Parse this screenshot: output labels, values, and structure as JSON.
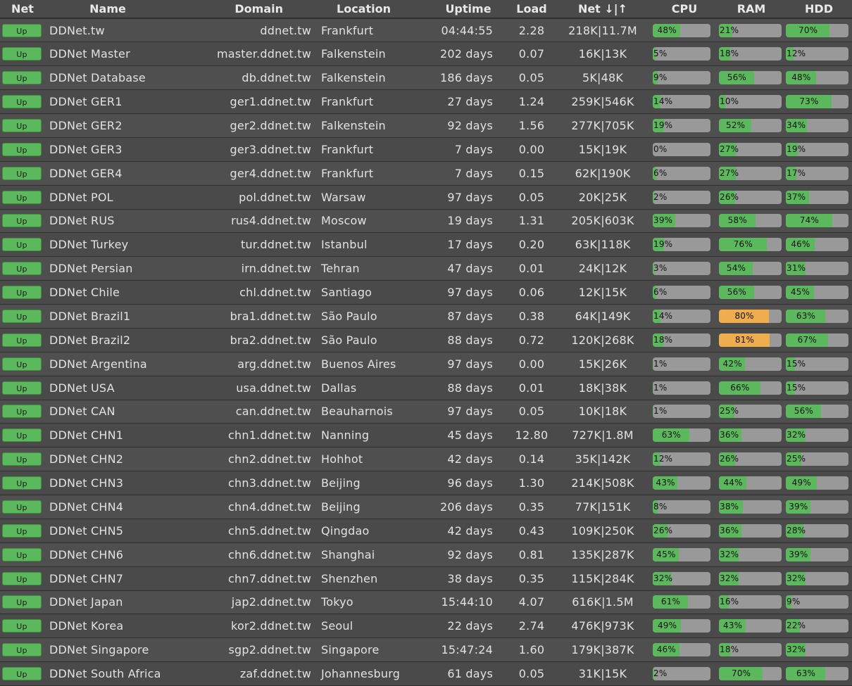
{
  "headers": {
    "net": "Net",
    "name": "Name",
    "domain": "Domain",
    "location": "Location",
    "uptime": "Uptime",
    "load": "Load",
    "netio": "Net ↓|↑",
    "cpu": "CPU",
    "ram": "RAM",
    "hdd": "HDD"
  },
  "colors": {
    "ok": "#5cb85c",
    "warn": "#f0ad4e",
    "track": "#999999"
  },
  "servers": [
    {
      "status": "Up",
      "name": "DDNet.tw",
      "domain": "ddnet.tw",
      "location": "Frankfurt",
      "uptime": "04:44:55",
      "load": "2.28",
      "net": "218K|11.7M",
      "cpu": 48,
      "ram": 21,
      "hdd": 70
    },
    {
      "status": "Up",
      "name": "DDNet Master",
      "domain": "master.ddnet.tw",
      "location": "Falkenstein",
      "uptime": "202 days",
      "load": "0.07",
      "net": "16K|13K",
      "cpu": 5,
      "ram": 18,
      "hdd": 12
    },
    {
      "status": "Up",
      "name": "DDNet Database",
      "domain": "db.ddnet.tw",
      "location": "Falkenstein",
      "uptime": "186 days",
      "load": "0.05",
      "net": "5K|48K",
      "cpu": 9,
      "ram": 56,
      "hdd": 48
    },
    {
      "status": "Up",
      "name": "DDNet GER1",
      "domain": "ger1.ddnet.tw",
      "location": "Frankfurt",
      "uptime": "27 days",
      "load": "1.24",
      "net": "259K|546K",
      "cpu": 14,
      "ram": 10,
      "hdd": 73
    },
    {
      "status": "Up",
      "name": "DDNet GER2",
      "domain": "ger2.ddnet.tw",
      "location": "Falkenstein",
      "uptime": "92 days",
      "load": "1.56",
      "net": "277K|705K",
      "cpu": 19,
      "ram": 52,
      "hdd": 34
    },
    {
      "status": "Up",
      "name": "DDNet GER3",
      "domain": "ger3.ddnet.tw",
      "location": "Frankfurt",
      "uptime": "7 days",
      "load": "0.00",
      "net": "15K|19K",
      "cpu": 0,
      "ram": 27,
      "hdd": 19
    },
    {
      "status": "Up",
      "name": "DDNet GER4",
      "domain": "ger4.ddnet.tw",
      "location": "Frankfurt",
      "uptime": "7 days",
      "load": "0.15",
      "net": "62K|190K",
      "cpu": 6,
      "ram": 27,
      "hdd": 17
    },
    {
      "status": "Up",
      "name": "DDNet POL",
      "domain": "pol.ddnet.tw",
      "location": "Warsaw",
      "uptime": "97 days",
      "load": "0.05",
      "net": "20K|25K",
      "cpu": 2,
      "ram": 26,
      "hdd": 37
    },
    {
      "status": "Up",
      "name": "DDNet RUS",
      "domain": "rus4.ddnet.tw",
      "location": "Moscow",
      "uptime": "19 days",
      "load": "1.31",
      "net": "205K|603K",
      "cpu": 39,
      "ram": 58,
      "hdd": 74
    },
    {
      "status": "Up",
      "name": "DDNet Turkey",
      "domain": "tur.ddnet.tw",
      "location": "Istanbul",
      "uptime": "17 days",
      "load": "0.20",
      "net": "63K|118K",
      "cpu": 19,
      "ram": 76,
      "hdd": 46
    },
    {
      "status": "Up",
      "name": "DDNet Persian",
      "domain": "irn.ddnet.tw",
      "location": "Tehran",
      "uptime": "47 days",
      "load": "0.01",
      "net": "24K|12K",
      "cpu": 3,
      "ram": 54,
      "hdd": 31
    },
    {
      "status": "Up",
      "name": "DDNet Chile",
      "domain": "chl.ddnet.tw",
      "location": "Santiago",
      "uptime": "97 days",
      "load": "0.06",
      "net": "12K|15K",
      "cpu": 6,
      "ram": 56,
      "hdd": 45
    },
    {
      "status": "Up",
      "name": "DDNet Brazil1",
      "domain": "bra1.ddnet.tw",
      "location": "São Paulo",
      "uptime": "87 days",
      "load": "0.38",
      "net": "64K|149K",
      "cpu": 14,
      "ram": 80,
      "hdd": 63
    },
    {
      "status": "Up",
      "name": "DDNet Brazil2",
      "domain": "bra2.ddnet.tw",
      "location": "São Paulo",
      "uptime": "88 days",
      "load": "0.72",
      "net": "120K|268K",
      "cpu": 18,
      "ram": 81,
      "hdd": 67
    },
    {
      "status": "Up",
      "name": "DDNet Argentina",
      "domain": "arg.ddnet.tw",
      "location": "Buenos Aires",
      "uptime": "97 days",
      "load": "0.00",
      "net": "15K|26K",
      "cpu": 1,
      "ram": 42,
      "hdd": 15
    },
    {
      "status": "Up",
      "name": "DDNet USA",
      "domain": "usa.ddnet.tw",
      "location": "Dallas",
      "uptime": "88 days",
      "load": "0.01",
      "net": "18K|38K",
      "cpu": 1,
      "ram": 66,
      "hdd": 15
    },
    {
      "status": "Up",
      "name": "DDNet CAN",
      "domain": "can.ddnet.tw",
      "location": "Beauharnois",
      "uptime": "97 days",
      "load": "0.05",
      "net": "10K|18K",
      "cpu": 1,
      "ram": 25,
      "hdd": 56
    },
    {
      "status": "Up",
      "name": "DDNet CHN1",
      "domain": "chn1.ddnet.tw",
      "location": "Nanning",
      "uptime": "45 days",
      "load": "12.80",
      "net": "727K|1.8M",
      "cpu": 63,
      "ram": 36,
      "hdd": 32
    },
    {
      "status": "Up",
      "name": "DDNet CHN2",
      "domain": "chn2.ddnet.tw",
      "location": "Hohhot",
      "uptime": "42 days",
      "load": "0.14",
      "net": "35K|142K",
      "cpu": 12,
      "ram": 26,
      "hdd": 25
    },
    {
      "status": "Up",
      "name": "DDNet CHN3",
      "domain": "chn3.ddnet.tw",
      "location": "Beijing",
      "uptime": "96 days",
      "load": "1.30",
      "net": "214K|508K",
      "cpu": 43,
      "ram": 44,
      "hdd": 49
    },
    {
      "status": "Up",
      "name": "DDNet CHN4",
      "domain": "chn4.ddnet.tw",
      "location": "Beijing",
      "uptime": "206 days",
      "load": "0.35",
      "net": "77K|151K",
      "cpu": 8,
      "ram": 38,
      "hdd": 39
    },
    {
      "status": "Up",
      "name": "DDNet CHN5",
      "domain": "chn5.ddnet.tw",
      "location": "Qingdao",
      "uptime": "42 days",
      "load": "0.43",
      "net": "109K|250K",
      "cpu": 26,
      "ram": 36,
      "hdd": 28
    },
    {
      "status": "Up",
      "name": "DDNet CHN6",
      "domain": "chn6.ddnet.tw",
      "location": "Shanghai",
      "uptime": "92 days",
      "load": "0.81",
      "net": "135K|287K",
      "cpu": 45,
      "ram": 32,
      "hdd": 39
    },
    {
      "status": "Up",
      "name": "DDNet CHN7",
      "domain": "chn7.ddnet.tw",
      "location": "Shenzhen",
      "uptime": "38 days",
      "load": "0.35",
      "net": "115K|284K",
      "cpu": 32,
      "ram": 32,
      "hdd": 32
    },
    {
      "status": "Up",
      "name": "DDNet Japan",
      "domain": "jap2.ddnet.tw",
      "location": "Tokyo",
      "uptime": "15:44:10",
      "load": "4.07",
      "net": "616K|1.5M",
      "cpu": 61,
      "ram": 16,
      "hdd": 9
    },
    {
      "status": "Up",
      "name": "DDNet Korea",
      "domain": "kor2.ddnet.tw",
      "location": "Seoul",
      "uptime": "22 days",
      "load": "2.74",
      "net": "476K|973K",
      "cpu": 49,
      "ram": 43,
      "hdd": 22
    },
    {
      "status": "Up",
      "name": "DDNet Singapore",
      "domain": "sgp2.ddnet.tw",
      "location": "Singapore",
      "uptime": "15:47:24",
      "load": "1.60",
      "net": "179K|387K",
      "cpu": 46,
      "ram": 18,
      "hdd": 32
    },
    {
      "status": "Up",
      "name": "DDNet South Africa",
      "domain": "zaf.ddnet.tw",
      "location": "Johannesburg",
      "uptime": "61 days",
      "load": "0.05",
      "net": "31K|15K",
      "cpu": 2,
      "ram": 70,
      "hdd": 63
    }
  ]
}
